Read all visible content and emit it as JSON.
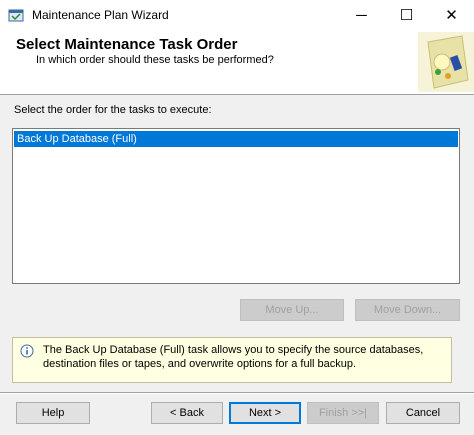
{
  "window": {
    "title": "Maintenance Plan Wizard",
    "minimize_glyph": "─",
    "maximize_glyph": "☐",
    "close_glyph": "✕"
  },
  "header": {
    "title": "Select Maintenance Task Order",
    "subtitle": "In which order should these tasks be performed?"
  },
  "instruction": "Select the order for the tasks to execute:",
  "tasks": [
    "Back Up Database (Full)"
  ],
  "selected_task_index": 0,
  "order_buttons": {
    "move_up": "Move Up...",
    "move_down": "Move Down..."
  },
  "description": "The Back Up Database (Full) task allows you to specify the source databases, destination files or tapes, and overwrite options for a full backup.",
  "footer": {
    "help": "Help",
    "back": "< Back",
    "next": "Next >",
    "finish": "Finish >>|",
    "cancel": "Cancel"
  },
  "colors": {
    "selection": "#0078d7",
    "info_background": "#ffffe1"
  },
  "icons": {
    "app": "wizard-icon",
    "header_art": "maintenance-plan-graphic",
    "info": "info-icon"
  }
}
